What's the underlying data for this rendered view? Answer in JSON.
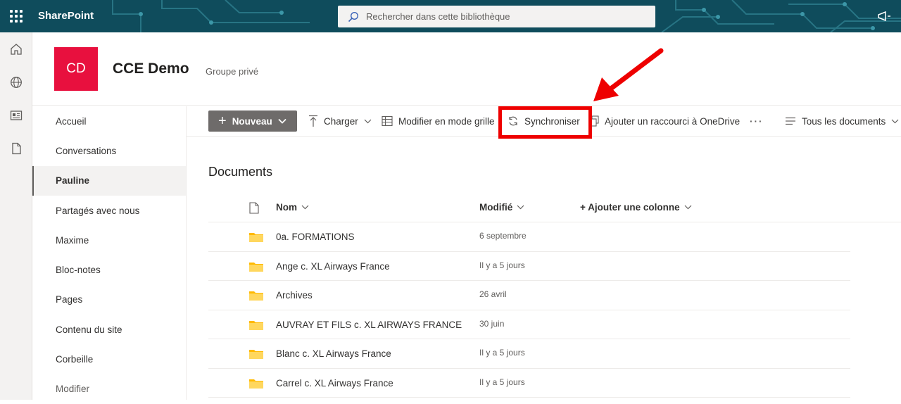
{
  "suitebar": {
    "app_name": "SharePoint",
    "search_placeholder": "Rechercher dans cette bibliothèque",
    "bg_color": "#0f4c5c"
  },
  "rail": {
    "items": [
      {
        "icon": "home-icon"
      },
      {
        "icon": "globe-icon"
      },
      {
        "icon": "news-icon"
      },
      {
        "icon": "document-icon"
      }
    ]
  },
  "site": {
    "logo_text": "CD",
    "logo_color": "#e8103e",
    "title": "CCE Demo",
    "subtitle": "Groupe privé"
  },
  "nav": {
    "items": [
      {
        "label": "Accueil"
      },
      {
        "label": "Conversations"
      },
      {
        "label": "Pauline"
      },
      {
        "label": "Partagés avec nous"
      },
      {
        "label": "Maxime"
      },
      {
        "label": "Bloc-notes"
      },
      {
        "label": "Pages"
      },
      {
        "label": "Contenu du site"
      },
      {
        "label": "Corbeille"
      },
      {
        "label": "Modifier"
      }
    ],
    "active": "Pauline"
  },
  "commands": {
    "new_label": "Nouveau",
    "upload_label": "Charger",
    "grid_label": "Modifier en mode grille",
    "sync_label": "Synchroniser",
    "shortcut_label": "Ajouter un raccourci à OneDrive",
    "more_label": "···",
    "view_label": "Tous les documents"
  },
  "annotation": {
    "highlight_color": "#ee0000",
    "highlighted": "Synchroniser"
  },
  "library": {
    "title": "Documents",
    "columns": {
      "name": "Nom",
      "modified": "Modifié",
      "add": "+ Ajouter une colonne"
    },
    "rows": [
      {
        "name": "0a. FORMATIONS",
        "modified": "6 septembre"
      },
      {
        "name": "Ange c. XL Airways France",
        "modified": "Il y a 5 jours"
      },
      {
        "name": "Archives",
        "modified": "26 avril"
      },
      {
        "name": "AUVRAY ET FILS c. XL AIRWAYS FRANCE",
        "modified": "30 juin"
      },
      {
        "name": "Blanc c. XL Airways France",
        "modified": "Il y a 5 jours"
      },
      {
        "name": "Carrel c. XL Airways France",
        "modified": "Il y a 5 jours"
      }
    ]
  }
}
